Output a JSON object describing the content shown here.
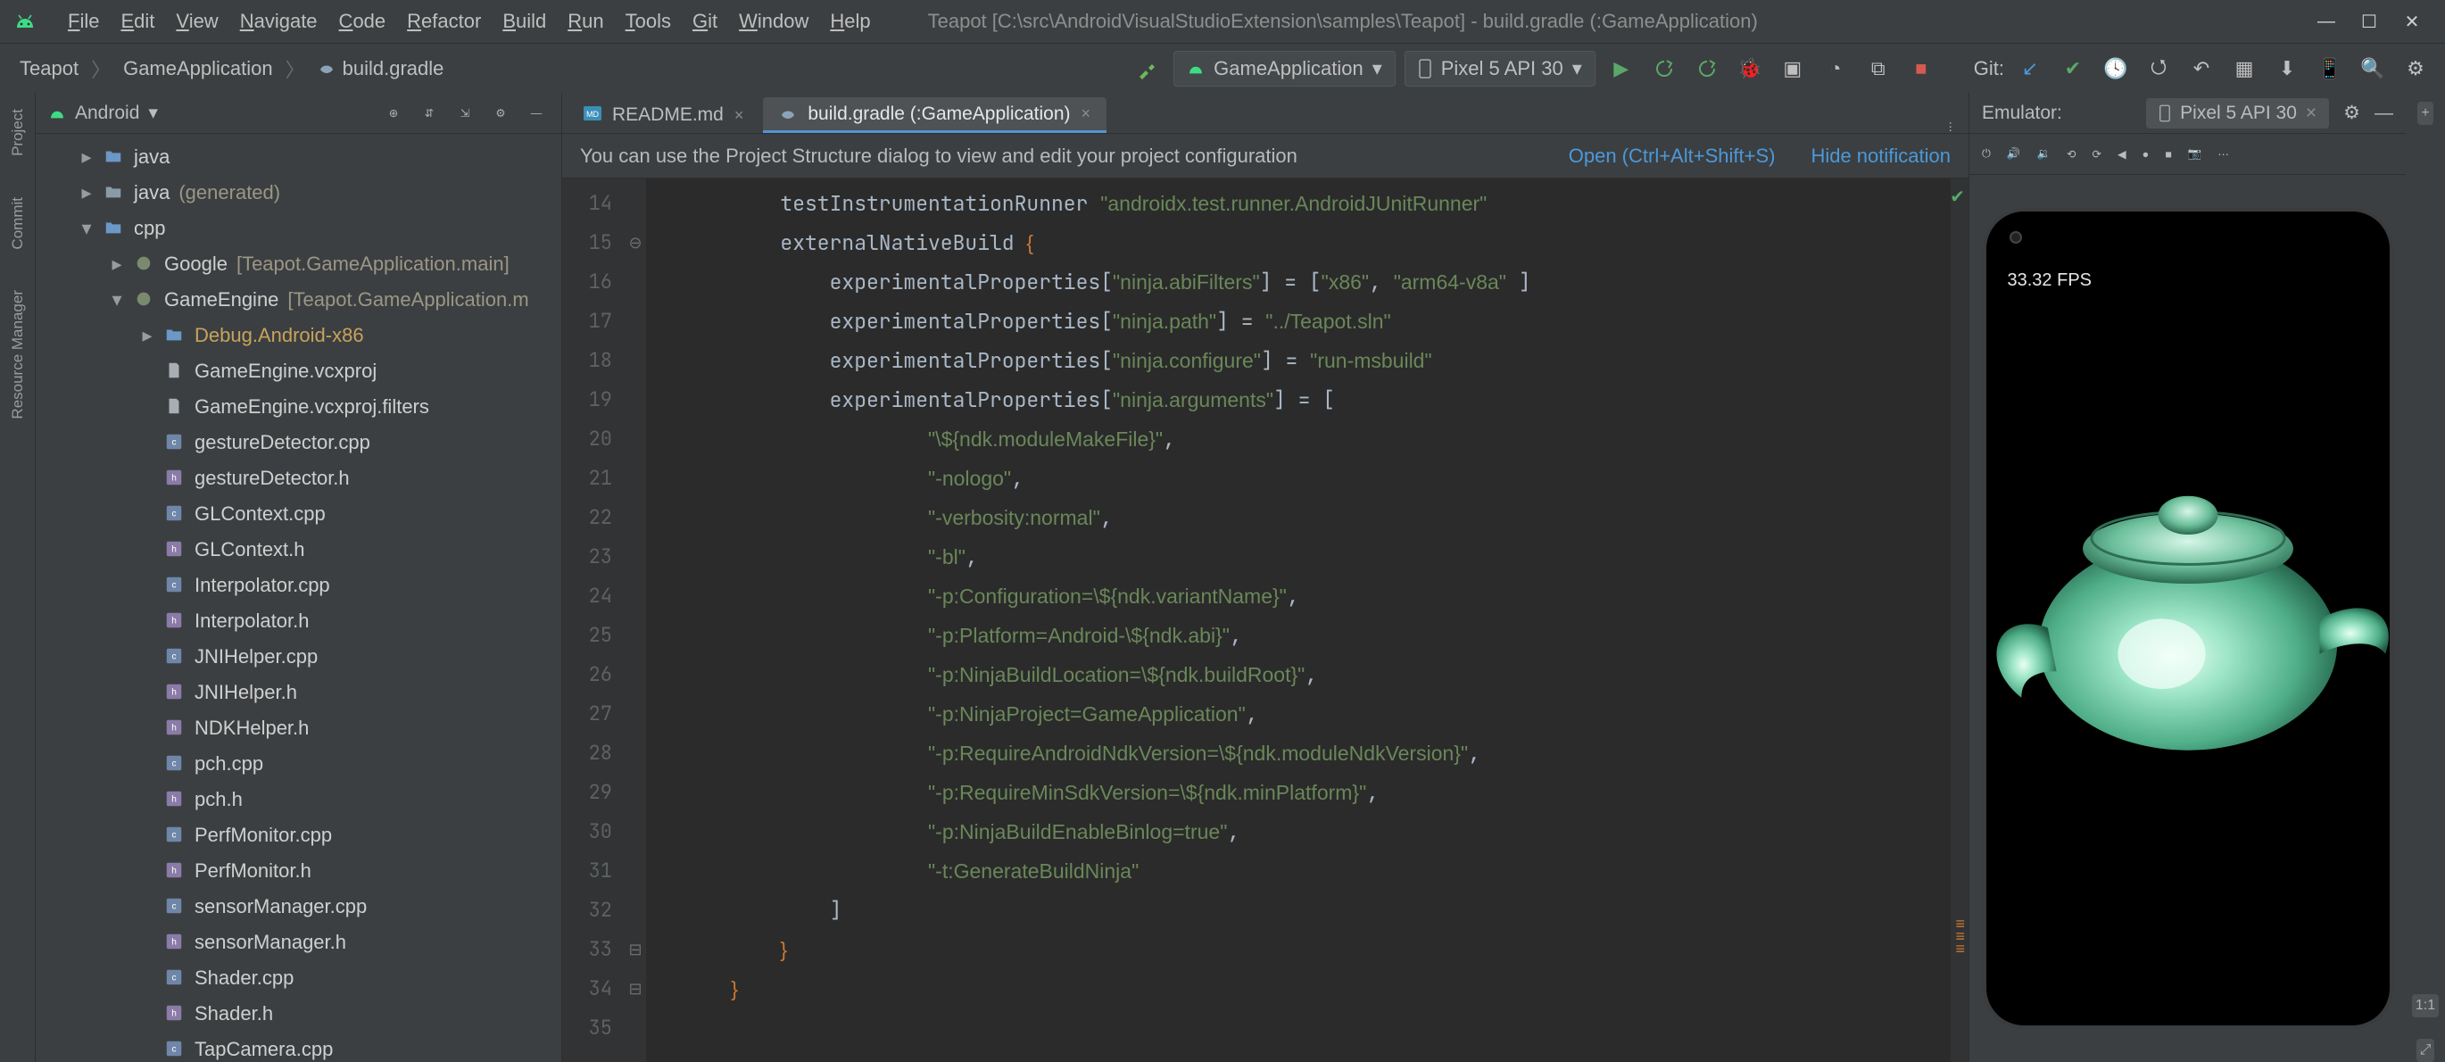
{
  "window_title": "Teapot [C:\\src\\AndroidVisualStudioExtension\\samples\\Teapot] - build.gradle (:GameApplication)",
  "menubar": [
    "File",
    "Edit",
    "View",
    "Navigate",
    "Code",
    "Refactor",
    "Build",
    "Run",
    "Tools",
    "Git",
    "Window",
    "Help"
  ],
  "breadcrumb": [
    "Teapot",
    "GameApplication",
    "build.gradle"
  ],
  "run_config": "GameApplication",
  "device_target": "Pixel 5 API 30",
  "git_label": "Git:",
  "left_tool_tabs": [
    "Project",
    "Commit",
    "Resource Manager"
  ],
  "tree_header": "Android",
  "tree": {
    "root_items": [
      {
        "indent": 1,
        "arrow": ">",
        "icon": "folder",
        "label": "java",
        "dim": ""
      },
      {
        "indent": 1,
        "arrow": ">",
        "icon": "folder-gen",
        "label": "java",
        "dim": "(generated)"
      },
      {
        "indent": 1,
        "arrow": "v",
        "icon": "folder",
        "label": "cpp",
        "dim": ""
      },
      {
        "indent": 2,
        "arrow": ">",
        "icon": "pkg",
        "label": "Google",
        "dim": "[Teapot.GameApplication.main]"
      },
      {
        "indent": 2,
        "arrow": "v",
        "icon": "pkg",
        "label": "GameEngine",
        "dim": "[Teapot.GameApplication.m"
      },
      {
        "indent": 3,
        "arrow": ">",
        "icon": "folder-h",
        "label": "Debug.Android-x86",
        "dim": "",
        "hl": true
      },
      {
        "indent": 3,
        "arrow": "",
        "icon": "file",
        "label": "GameEngine.vcxproj",
        "dim": ""
      },
      {
        "indent": 3,
        "arrow": "",
        "icon": "file",
        "label": "GameEngine.vcxproj.filters",
        "dim": ""
      },
      {
        "indent": 3,
        "arrow": "",
        "icon": "cpp",
        "label": "gestureDetector.cpp",
        "dim": ""
      },
      {
        "indent": 3,
        "arrow": "",
        "icon": "h",
        "label": "gestureDetector.h",
        "dim": ""
      },
      {
        "indent": 3,
        "arrow": "",
        "icon": "cpp",
        "label": "GLContext.cpp",
        "dim": ""
      },
      {
        "indent": 3,
        "arrow": "",
        "icon": "h",
        "label": "GLContext.h",
        "dim": ""
      },
      {
        "indent": 3,
        "arrow": "",
        "icon": "cpp",
        "label": "Interpolator.cpp",
        "dim": ""
      },
      {
        "indent": 3,
        "arrow": "",
        "icon": "h",
        "label": "Interpolator.h",
        "dim": ""
      },
      {
        "indent": 3,
        "arrow": "",
        "icon": "cpp",
        "label": "JNIHelper.cpp",
        "dim": ""
      },
      {
        "indent": 3,
        "arrow": "",
        "icon": "h",
        "label": "JNIHelper.h",
        "dim": ""
      },
      {
        "indent": 3,
        "arrow": "",
        "icon": "h",
        "label": "NDKHelper.h",
        "dim": ""
      },
      {
        "indent": 3,
        "arrow": "",
        "icon": "cpp",
        "label": "pch.cpp",
        "dim": ""
      },
      {
        "indent": 3,
        "arrow": "",
        "icon": "h",
        "label": "pch.h",
        "dim": ""
      },
      {
        "indent": 3,
        "arrow": "",
        "icon": "cpp",
        "label": "PerfMonitor.cpp",
        "dim": ""
      },
      {
        "indent": 3,
        "arrow": "",
        "icon": "h",
        "label": "PerfMonitor.h",
        "dim": ""
      },
      {
        "indent": 3,
        "arrow": "",
        "icon": "cpp",
        "label": "sensorManager.cpp",
        "dim": ""
      },
      {
        "indent": 3,
        "arrow": "",
        "icon": "h",
        "label": "sensorManager.h",
        "dim": ""
      },
      {
        "indent": 3,
        "arrow": "",
        "icon": "cpp",
        "label": "Shader.cpp",
        "dim": ""
      },
      {
        "indent": 3,
        "arrow": "",
        "icon": "h",
        "label": "Shader.h",
        "dim": ""
      },
      {
        "indent": 3,
        "arrow": "",
        "icon": "cpp",
        "label": "TapCamera.cpp",
        "dim": ""
      }
    ]
  },
  "editor_tabs": [
    {
      "label": "README.md",
      "icon": "md",
      "active": false,
      "close": true
    },
    {
      "label": "build.gradle (:GameApplication)",
      "icon": "gradle",
      "active": true,
      "close": true
    }
  ],
  "info_bar": {
    "message": "You can use the Project Structure dialog to view and edit your project configuration",
    "link_open": "Open (Ctrl+Alt+Shift+S)",
    "link_hide": "Hide notification"
  },
  "gutter_start": 14,
  "gutter_end": 35,
  "code_lines": [
    {
      "n": 14,
      "html": "        testInstrumentationRunner <span class='s-str'>\"androidx.test.runner.AndroidJUnitRunner\"</span>"
    },
    {
      "n": 15,
      "html": "        externalNativeBuild <span class='s-key'>{</span>"
    },
    {
      "n": 16,
      "html": "            experimentalProperties[<span class='s-str'>\"ninja.abiFilters\"</span>] = [<span class='s-str'>\"x86\"</span>, <span class='s-str'>\"arm64-v8a\"</span> ]"
    },
    {
      "n": 17,
      "html": "            experimentalProperties[<span class='s-str'>\"ninja.path\"</span>] = <span class='s-str'>\"../Teapot.sln\"</span>"
    },
    {
      "n": 18,
      "html": "            experimentalProperties[<span class='s-str'>\"ninja.configure\"</span>] = <span class='s-str'>\"run-msbuild\"</span>"
    },
    {
      "n": 19,
      "html": "            experimentalProperties[<span class='s-str'>\"ninja.arguments\"</span>] = ["
    },
    {
      "n": 20,
      "html": "                    <span class='s-str'>\"\\${ndk.moduleMakeFile}\"</span>,"
    },
    {
      "n": 21,
      "html": "                    <span class='s-str'>\"-nologo\"</span>,"
    },
    {
      "n": 22,
      "html": "                    <span class='s-str'>\"-verbosity:normal\"</span>,"
    },
    {
      "n": 23,
      "html": "                    <span class='s-str'>\"-bl\"</span>,"
    },
    {
      "n": 24,
      "html": "                    <span class='s-str'>\"-p:Configuration=\\${ndk.variantName}\"</span>,"
    },
    {
      "n": 25,
      "html": "                    <span class='s-str'>\"-p:Platform=Android-\\${ndk.abi}\"</span>,"
    },
    {
      "n": 26,
      "html": "                    <span class='s-str'>\"-p:NinjaBuildLocation=\\${ndk.buildRoot}\"</span>,"
    },
    {
      "n": 27,
      "html": "                    <span class='s-str'>\"-p:NinjaProject=GameApplication\"</span>,"
    },
    {
      "n": 28,
      "html": "                    <span class='s-str'>\"-p:RequireAndroidNdkVersion=\\${ndk.moduleNdkVersion}\"</span>,"
    },
    {
      "n": 29,
      "html": "                    <span class='s-str'>\"-p:RequireMinSdkVersion=\\${ndk.minPlatform}\"</span>,"
    },
    {
      "n": 30,
      "html": "                    <span class='s-str'>\"-p:NinjaBuildEnableBinlog=true\"</span>,"
    },
    {
      "n": 31,
      "html": "                    <span class='s-str'>\"-t:GenerateBuildNinja\"</span>"
    },
    {
      "n": 32,
      "html": "            ]"
    },
    {
      "n": 33,
      "html": "        <span class='s-key'>}</span>"
    },
    {
      "n": 34,
      "html": "    <span class='s-key'>}</span>"
    },
    {
      "n": 35,
      "html": ""
    }
  ],
  "emulator": {
    "header_label": "Emulator:",
    "device_tab": "Pixel 5 API 30",
    "fps": "33.32 FPS"
  },
  "right_strip": {
    "zoom_plus": "+",
    "zoom_label": "1:1",
    "zoom_fit": "⤢"
  }
}
